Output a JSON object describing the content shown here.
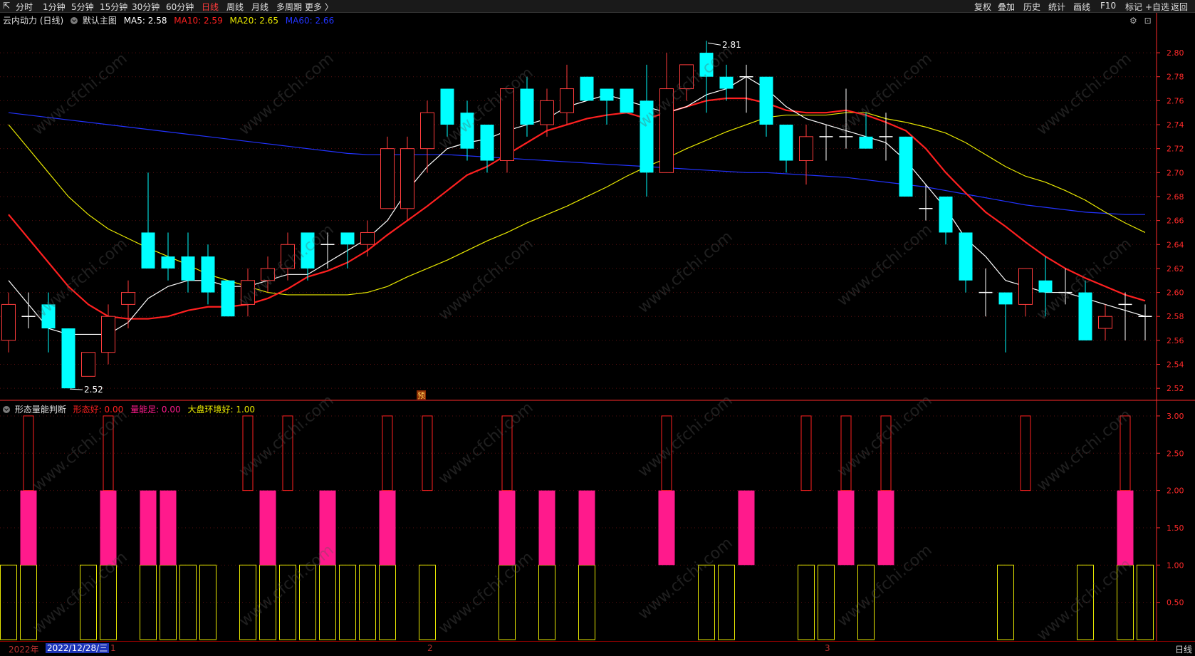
{
  "toolbar": {
    "left_items": [
      "分时",
      "1分钟",
      "5分钟",
      "15分钟",
      "30分钟",
      "60分钟",
      "日线",
      "周线",
      "月线",
      "多周期",
      "更多 〉"
    ],
    "active_index": 6,
    "right_items": [
      "复权",
      "叠加",
      "历史",
      "统计",
      "画线",
      "F10",
      "标记",
      "+自选",
      "返回"
    ]
  },
  "main_pane": {
    "title": "云内动力 (日线)",
    "indicator": "默认主图",
    "ma5_label": "MA5: 2.58",
    "ma10_label": "MA10: 2.59",
    "ma20_label": "MA20: 2.65",
    "ma60_label": "MA60: 2.66",
    "high_label": "2.81",
    "low_label": "2.52",
    "pre_badge": "预"
  },
  "sub_pane": {
    "title": "形态量能判断",
    "l1": "形态好: 0.00",
    "l2": "量能足: 0.00",
    "l3": "大盘环境好: 1.00"
  },
  "colors": {
    "up": "#ff3c3c",
    "down": "#00ffff",
    "ma5": "#ffffff",
    "ma10": "#ff2020",
    "ma20": "#e8e800",
    "ma60": "#2233ff",
    "volume_pink": "#ff1a8c",
    "axis": "#ff2a2a"
  },
  "price_axis": [
    "2.80",
    "2.78",
    "2.76",
    "2.74",
    "2.72",
    "2.70",
    "2.68",
    "2.66",
    "2.64",
    "2.62",
    "2.60",
    "2.58",
    "2.56",
    "2.54",
    "2.52"
  ],
  "sub_axis": [
    "3.00",
    "2.50",
    "2.00",
    "1.50",
    "1.00",
    "0.50"
  ],
  "status": {
    "year": "2022年",
    "date": "2022/12/28/三",
    "marks": [
      "1",
      "2",
      "3"
    ],
    "period": "日线"
  },
  "watermark": "www.cfchi.com",
  "chart_data": {
    "type": "candlestick",
    "candles": [
      {
        "o": 2.56,
        "c": 2.59,
        "h": 2.6,
        "l": 2.55
      },
      {
        "o": 2.58,
        "c": 2.58,
        "h": 2.6,
        "l": 2.57
      },
      {
        "o": 2.59,
        "c": 2.57,
        "h": 2.6,
        "l": 2.55
      },
      {
        "o": 2.57,
        "c": 2.52,
        "h": 2.57,
        "l": 2.52
      },
      {
        "o": 2.53,
        "c": 2.55,
        "h": 2.55,
        "l": 2.53
      },
      {
        "o": 2.55,
        "c": 2.58,
        "h": 2.59,
        "l": 2.54
      },
      {
        "o": 2.59,
        "c": 2.6,
        "h": 2.61,
        "l": 2.57
      },
      {
        "o": 2.65,
        "c": 2.62,
        "h": 2.7,
        "l": 2.62
      },
      {
        "o": 2.63,
        "c": 2.62,
        "h": 2.65,
        "l": 2.61
      },
      {
        "o": 2.63,
        "c": 2.61,
        "h": 2.65,
        "l": 2.6
      },
      {
        "o": 2.63,
        "c": 2.6,
        "h": 2.64,
        "l": 2.59
      },
      {
        "o": 2.61,
        "c": 2.58,
        "h": 2.61,
        "l": 2.58
      },
      {
        "o": 2.59,
        "c": 2.61,
        "h": 2.62,
        "l": 2.58
      },
      {
        "o": 2.61,
        "c": 2.62,
        "h": 2.63,
        "l": 2.6
      },
      {
        "o": 2.62,
        "c": 2.64,
        "h": 2.65,
        "l": 2.61
      },
      {
        "o": 2.65,
        "c": 2.62,
        "h": 2.65,
        "l": 2.61
      },
      {
        "o": 2.64,
        "c": 2.64,
        "h": 2.65,
        "l": 2.62
      },
      {
        "o": 2.65,
        "c": 2.64,
        "h": 2.65,
        "l": 2.62
      },
      {
        "o": 2.64,
        "c": 2.65,
        "h": 2.66,
        "l": 2.63
      },
      {
        "o": 2.67,
        "c": 2.72,
        "h": 2.73,
        "l": 2.67
      },
      {
        "o": 2.67,
        "c": 2.72,
        "h": 2.73,
        "l": 2.66
      },
      {
        "o": 2.72,
        "c": 2.75,
        "h": 2.76,
        "l": 2.7
      },
      {
        "o": 2.77,
        "c": 2.74,
        "h": 2.77,
        "l": 2.73
      },
      {
        "o": 2.75,
        "c": 2.72,
        "h": 2.76,
        "l": 2.71
      },
      {
        "o": 2.74,
        "c": 2.71,
        "h": 2.74,
        "l": 2.7
      },
      {
        "o": 2.71,
        "c": 2.77,
        "h": 2.77,
        "l": 2.7
      },
      {
        "o": 2.77,
        "c": 2.74,
        "h": 2.78,
        "l": 2.73
      },
      {
        "o": 2.74,
        "c": 2.76,
        "h": 2.77,
        "l": 2.73
      },
      {
        "o": 2.75,
        "c": 2.77,
        "h": 2.79,
        "l": 2.74
      },
      {
        "o": 2.78,
        "c": 2.76,
        "h": 2.78,
        "l": 2.76
      },
      {
        "o": 2.77,
        "c": 2.76,
        "h": 2.77,
        "l": 2.74
      },
      {
        "o": 2.77,
        "c": 2.75,
        "h": 2.77,
        "l": 2.75
      },
      {
        "o": 2.76,
        "c": 2.7,
        "h": 2.79,
        "l": 2.68
      },
      {
        "o": 2.7,
        "c": 2.77,
        "h": 2.8,
        "l": 2.7
      },
      {
        "o": 2.77,
        "c": 2.79,
        "h": 2.79,
        "l": 2.76
      },
      {
        "o": 2.8,
        "c": 2.78,
        "h": 2.81,
        "l": 2.75
      },
      {
        "o": 2.78,
        "c": 2.77,
        "h": 2.79,
        "l": 2.76
      },
      {
        "o": 2.78,
        "c": 2.78,
        "h": 2.79,
        "l": 2.75
      },
      {
        "o": 2.78,
        "c": 2.74,
        "h": 2.78,
        "l": 2.73
      },
      {
        "o": 2.74,
        "c": 2.71,
        "h": 2.74,
        "l": 2.7
      },
      {
        "o": 2.71,
        "c": 2.73,
        "h": 2.74,
        "l": 2.69
      },
      {
        "o": 2.73,
        "c": 2.73,
        "h": 2.74,
        "l": 2.71
      },
      {
        "o": 2.73,
        "c": 2.73,
        "h": 2.77,
        "l": 2.72
      },
      {
        "o": 2.73,
        "c": 2.72,
        "h": 2.75,
        "l": 2.72
      },
      {
        "o": 2.73,
        "c": 2.73,
        "h": 2.75,
        "l": 2.71
      },
      {
        "o": 2.73,
        "c": 2.68,
        "h": 2.73,
        "l": 2.68
      },
      {
        "o": 2.67,
        "c": 2.67,
        "h": 2.69,
        "l": 2.66
      },
      {
        "o": 2.68,
        "c": 2.65,
        "h": 2.68,
        "l": 2.64
      },
      {
        "o": 2.65,
        "c": 2.61,
        "h": 2.65,
        "l": 2.6
      },
      {
        "o": 2.6,
        "c": 2.6,
        "h": 2.62,
        "l": 2.58
      },
      {
        "o": 2.6,
        "c": 2.59,
        "h": 2.6,
        "l": 2.55
      },
      {
        "o": 2.59,
        "c": 2.62,
        "h": 2.62,
        "l": 2.58
      },
      {
        "o": 2.61,
        "c": 2.6,
        "h": 2.63,
        "l": 2.58
      },
      {
        "o": 2.6,
        "c": 2.6,
        "h": 2.62,
        "l": 2.59
      },
      {
        "o": 2.6,
        "c": 2.56,
        "h": 2.61,
        "l": 2.56
      },
      {
        "o": 2.57,
        "c": 2.58,
        "h": 2.59,
        "l": 2.56
      },
      {
        "o": 2.59,
        "c": 2.59,
        "h": 2.6,
        "l": 2.56
      },
      {
        "o": 2.58,
        "c": 2.58,
        "h": 2.59,
        "l": 2.56
      }
    ],
    "ma5": [
      2.61,
      2.59,
      2.57,
      2.565,
      2.565,
      2.565,
      2.575,
      2.595,
      2.605,
      2.61,
      2.61,
      2.605,
      2.605,
      2.61,
      2.615,
      2.615,
      2.625,
      2.635,
      2.645,
      2.66,
      2.685,
      2.705,
      2.72,
      2.725,
      2.728,
      2.735,
      2.74,
      2.745,
      2.755,
      2.76,
      2.765,
      2.76,
      2.755,
      2.75,
      2.755,
      2.765,
      2.77,
      2.78,
      2.77,
      2.755,
      2.745,
      2.74,
      2.735,
      2.73,
      2.725,
      2.71,
      2.69,
      2.67,
      2.645,
      2.63,
      2.61,
      2.605,
      2.6,
      2.6,
      2.595,
      2.59,
      2.585,
      2.58
    ],
    "ma10": [
      2.665,
      2.645,
      2.625,
      2.605,
      2.59,
      2.58,
      2.578,
      2.578,
      2.58,
      2.585,
      2.588,
      2.588,
      2.59,
      2.595,
      2.603,
      2.613,
      2.618,
      2.625,
      2.635,
      2.648,
      2.66,
      2.672,
      2.685,
      2.698,
      2.705,
      2.715,
      2.725,
      2.735,
      2.74,
      2.745,
      2.748,
      2.75,
      2.745,
      2.75,
      2.755,
      2.76,
      2.762,
      2.762,
      2.758,
      2.752,
      2.75,
      2.75,
      2.752,
      2.748,
      2.742,
      2.735,
      2.72,
      2.7,
      2.683,
      2.667,
      2.655,
      2.642,
      2.63,
      2.62,
      2.612,
      2.605,
      2.598,
      2.593
    ],
    "ma20": [
      2.74,
      2.72,
      2.7,
      2.68,
      2.665,
      2.653,
      2.645,
      2.637,
      2.63,
      2.623,
      2.615,
      2.61,
      2.605,
      2.6,
      2.598,
      2.598,
      2.598,
      2.598,
      2.6,
      2.605,
      2.613,
      2.62,
      2.627,
      2.635,
      2.643,
      2.65,
      2.658,
      2.665,
      2.672,
      2.68,
      2.688,
      2.697,
      2.705,
      2.712,
      2.72,
      2.727,
      2.734,
      2.74,
      2.746,
      2.748,
      2.748,
      2.748,
      2.75,
      2.75,
      2.745,
      2.742,
      2.738,
      2.733,
      2.725,
      2.715,
      2.705,
      2.697,
      2.692,
      2.685,
      2.677,
      2.667,
      2.658,
      2.65
    ],
    "ma60": [
      2.75,
      2.748,
      2.746,
      2.744,
      2.742,
      2.74,
      2.738,
      2.736,
      2.734,
      2.732,
      2.73,
      2.728,
      2.726,
      2.724,
      2.722,
      2.72,
      2.718,
      2.716,
      2.715,
      2.715,
      2.715,
      2.715,
      2.715,
      2.714,
      2.713,
      2.712,
      2.711,
      2.71,
      2.709,
      2.708,
      2.707,
      2.706,
      2.705,
      2.704,
      2.703,
      2.702,
      2.701,
      2.7,
      2.7,
      2.699,
      2.698,
      2.697,
      2.696,
      2.694,
      2.692,
      2.69,
      2.688,
      2.685,
      2.682,
      2.679,
      2.676,
      2.673,
      2.671,
      2.669,
      2.667,
      2.666,
      2.665,
      2.665
    ],
    "sub_indicator": {
      "red_outline": [
        0,
        3,
        0,
        0,
        0,
        3,
        0,
        0,
        0,
        0,
        0,
        0,
        3,
        0,
        3,
        0,
        0,
        0,
        0,
        3,
        0,
        3,
        0,
        0,
        0,
        3,
        0,
        0,
        0,
        0,
        0,
        0,
        0,
        3,
        0,
        0,
        0,
        0,
        0,
        0,
        3,
        0,
        3,
        0,
        3,
        0,
        0,
        0,
        0,
        0,
        0,
        3,
        0,
        0,
        0,
        0,
        3,
        0
      ],
      "pink": [
        0,
        2,
        0,
        0,
        0,
        2,
        0,
        2,
        2,
        0,
        0,
        0,
        0,
        2,
        0,
        0,
        2,
        0,
        0,
        2,
        0,
        0,
        0,
        0,
        0,
        2,
        0,
        2,
        0,
        2,
        0,
        0,
        0,
        2,
        0,
        0,
        0,
        2,
        0,
        0,
        0,
        0,
        2,
        0,
        2,
        0,
        0,
        0,
        0,
        0,
        0,
        0,
        0,
        0,
        0,
        0,
        2,
        0
      ],
      "yellow": [
        1,
        1,
        0,
        0,
        1,
        1,
        0,
        1,
        1,
        1,
        1,
        0,
        1,
        1,
        1,
        1,
        1,
        1,
        1,
        1,
        0,
        1,
        0,
        0,
        0,
        1,
        0,
        1,
        0,
        1,
        0,
        0,
        0,
        0,
        0,
        1,
        1,
        0,
        0,
        0,
        1,
        1,
        0,
        1,
        0,
        0,
        0,
        0,
        0,
        0,
        1,
        0,
        0,
        0,
        1,
        0,
        1,
        1
      ]
    }
  }
}
